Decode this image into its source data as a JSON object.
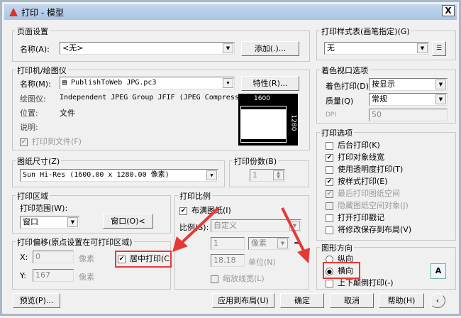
{
  "window": {
    "title": "打印 - 模型",
    "close": "X"
  },
  "page_setup": {
    "label": "页面设置",
    "name_label": "名称(A):",
    "name_value": "<无>",
    "add_button": "添加(.)..."
  },
  "printer": {
    "label": "打印机/绘图仪",
    "name_label": "名称(M):",
    "name_value": "PublishToWeb JPG.pc3",
    "properties_button": "特性(R)...",
    "plotter_label": "绘图仪:",
    "plotter_value": "Independent JPEG Group JFIF (JPEG Compressi...",
    "location_label": "位置:",
    "location_value": "文件",
    "description_label": "说明:",
    "print_to_file": "打印到文件(F)",
    "preview_width": "1600",
    "preview_height": "1280"
  },
  "paper_size": {
    "label": "图纸尺寸(Z)",
    "value": "Sun Hi-Res (1600.00 x 1280.00 像素)"
  },
  "copies": {
    "label": "打印份数(B)",
    "value": "1"
  },
  "plot_area": {
    "label": "打印区域",
    "range_label": "打印范围(W):",
    "range_value": "窗口",
    "window_button": "窗口(O)<"
  },
  "plot_offset": {
    "label": "打印偏移(原点设置在可打印区域)",
    "x_label": "X:",
    "x_value": "0",
    "x_unit": "像素",
    "y_label": "Y:",
    "y_value": "167",
    "y_unit": "像素",
    "center": "居中打印(C"
  },
  "plot_scale": {
    "label": "打印比例",
    "fit": "布满图纸(I)",
    "scale_label": "比例(S):",
    "scale_value": "自定义",
    "v1": "1",
    "unit1": "像素",
    "equals": "=",
    "v2": "18.18",
    "unit2": "单位(N)",
    "scale_lw": "缩放线宽(L)"
  },
  "style_table": {
    "label": "打印样式表(画笔指定)(G)",
    "value": "无"
  },
  "shaded": {
    "label": "着色视口选项",
    "shade_label": "着色打印(D)",
    "shade_value": "按显示",
    "quality_label": "质量(Q)",
    "quality_value": "常规",
    "dpi_label": "DPI",
    "dpi_value": "50"
  },
  "options": {
    "label": "打印选项",
    "items": [
      "后台打印(K)",
      "打印对象线宽",
      "使用透明度打印(T)",
      "按样式打印(E)",
      "最后打印图纸空间",
      "隐藏图纸空间对象(J)",
      "打开打印戳记",
      "将修改保存到布局(V)"
    ]
  },
  "orientation": {
    "label": "图形方向",
    "portrait": "纵向",
    "landscape": "横向",
    "upside": "上下颠倒打印(-)"
  },
  "buttons": {
    "preview": "预览(P)...",
    "apply": "应用到布局(U)",
    "ok": "确定",
    "cancel": "取消",
    "help": "帮助(H)"
  },
  "colors": {
    "annotation": "#e53935"
  }
}
